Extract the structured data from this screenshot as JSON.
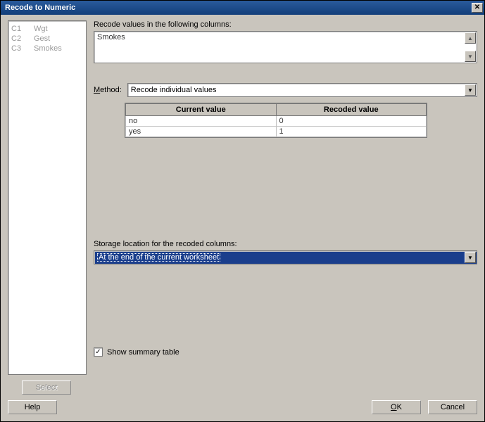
{
  "title": "Recode to Numeric",
  "columns": [
    {
      "id": "C1",
      "name": "Wgt"
    },
    {
      "id": "C2",
      "name": "Gest"
    },
    {
      "id": "C3",
      "name": "Smokes"
    }
  ],
  "labels": {
    "recode_values": "Recode values in the following columns:",
    "method": "Method:",
    "method_underline": "M",
    "storage": "Storage location for the recoded columns:",
    "show_summary": "Show summary table",
    "select_btn": "Select",
    "help_btn": "Help",
    "ok_btn": "OK",
    "ok_underline": "O",
    "cancel_btn": "Cancel"
  },
  "recode_columns_value": "Smokes",
  "method_value": "Recode individual values",
  "storage_value": "At the end of the current worksheet",
  "show_summary_checked": true,
  "recode_table": {
    "headers": {
      "current": "Current value",
      "recoded": "Recoded value"
    },
    "rows": [
      {
        "current": "no",
        "recoded": "0"
      },
      {
        "current": "yes",
        "recoded": "1"
      }
    ]
  }
}
